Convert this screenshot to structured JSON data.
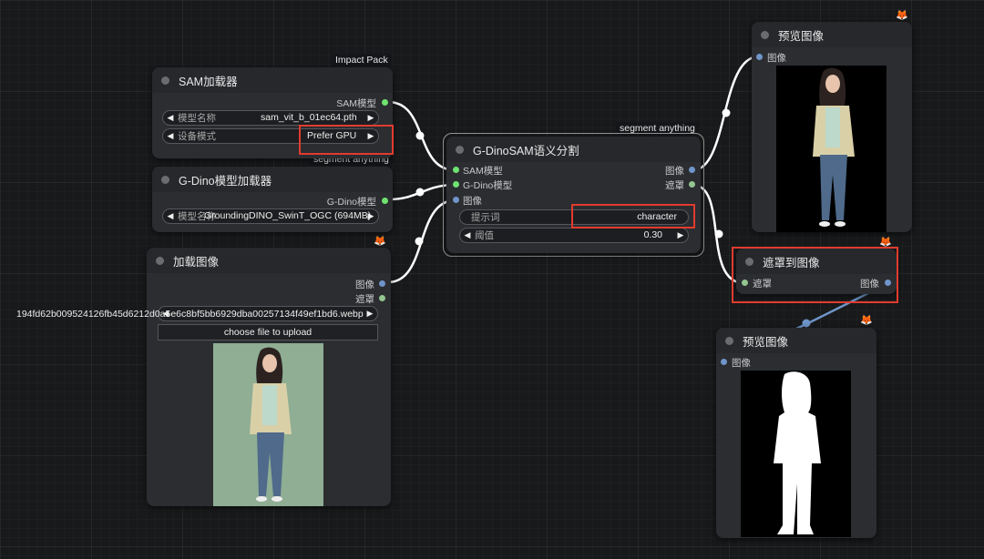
{
  "badges": {
    "impact_pack": "Impact Pack",
    "segment_anything_1": "segment anything",
    "segment_anything_2": "segment anything"
  },
  "sam_loader": {
    "title": "SAM加载器",
    "output": "SAM模型",
    "model_label": "模型名称",
    "model_value": "sam_vit_b_01ec64.pth",
    "device_label": "设备模式",
    "device_value": "Prefer GPU"
  },
  "gdino_loader": {
    "title": "G-Dino模型加载器",
    "output": "G-Dino模型",
    "model_label": "模型名称",
    "model_value": "GroundingDINO_SwinT_OGC (694MB)"
  },
  "load_image": {
    "title": "加载图像",
    "output_image": "图像",
    "output_mask": "遮罩",
    "filename": "194fd62b009524126fb45d6212d0a5e6c8bf5bb6929dba00257134f49ef1bd6.webp",
    "upload_label": "choose file to upload"
  },
  "gdino_sam": {
    "title": "G-DinoSAM语义分割",
    "input_sam": "SAM模型",
    "input_gdino": "G-Dino模型",
    "input_image": "图像",
    "output_image": "图像",
    "output_mask": "遮罩",
    "prompt_label": "提示词",
    "prompt_value": "character",
    "threshold_label": "阈值",
    "threshold_value": "0.30"
  },
  "preview_top": {
    "title": "预览图像",
    "input": "图像"
  },
  "mask_to_image": {
    "title": "遮罩到图像",
    "input": "遮罩",
    "output": "图像"
  },
  "preview_bottom": {
    "title": "预览图像",
    "input": "图像"
  },
  "fox_icon": "🦊",
  "arrow_left": "◀",
  "arrow_right": "▶",
  "colors": {
    "canvas": "#18191b",
    "node_bg": "#2b2d31",
    "highlight": "#e23b2e",
    "link": "#ffffff",
    "link_image": "#6f95c9"
  }
}
